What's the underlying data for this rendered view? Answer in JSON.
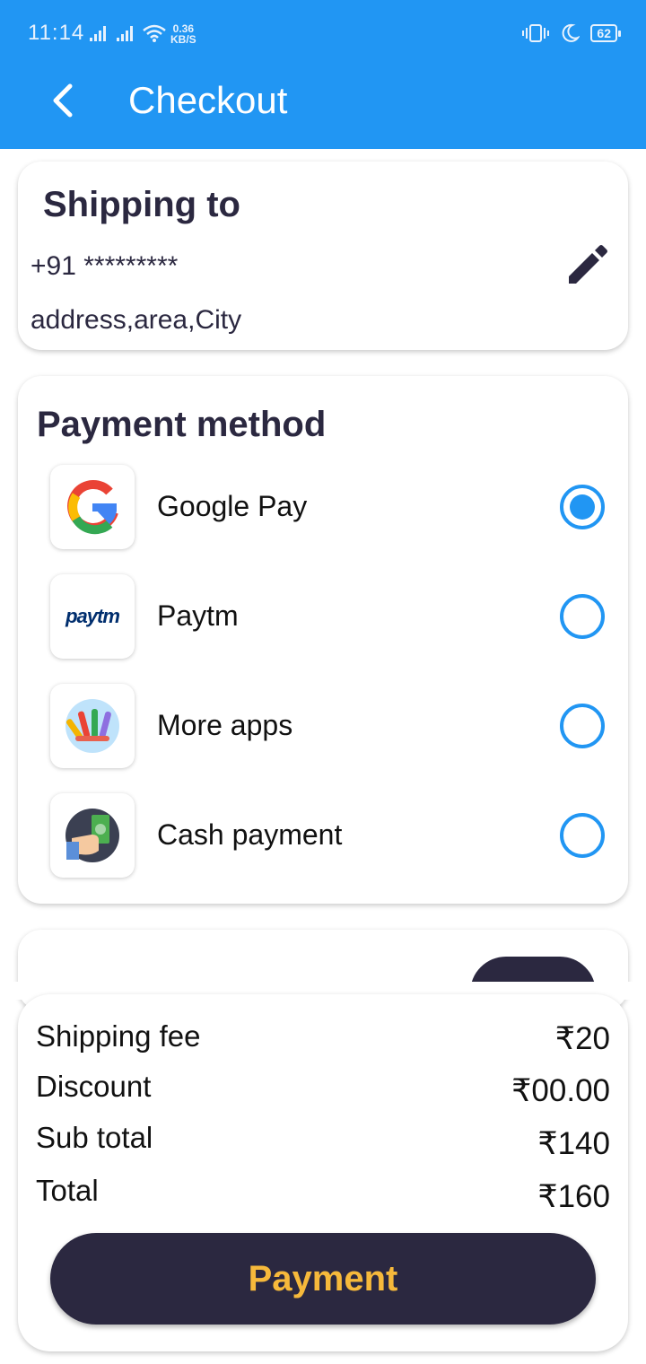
{
  "status_bar": {
    "time": "11:14",
    "net_speed_value": "0.36",
    "net_speed_unit": "KB/S",
    "battery": "62"
  },
  "app_bar": {
    "title": "Checkout",
    "back_icon": "arrow-back-icon"
  },
  "shipping": {
    "title": "Shipping to",
    "phone": "+91 *********",
    "address": "address,area,City",
    "edit_icon": "pencil-icon"
  },
  "payment": {
    "title": "Payment method",
    "methods": [
      {
        "label": "Google Pay",
        "icon": "google-pay-icon",
        "selected": true
      },
      {
        "label": "Paytm",
        "icon": "paytm-icon",
        "logo_text": "paytm",
        "selected": false
      },
      {
        "label": "More apps",
        "icon": "more-apps-icon",
        "selected": false
      },
      {
        "label": "Cash payment",
        "icon": "cash-payment-icon",
        "selected": false
      }
    ]
  },
  "summary": {
    "shipping_fee_label": "Shipping fee",
    "shipping_fee_value": "₹20",
    "discount_label": "Discount",
    "discount_value": "₹00.00",
    "subtotal_label": "Sub total",
    "subtotal_value": "₹140",
    "total_label": "Total",
    "total_value": "₹160",
    "button_label": "Payment"
  },
  "colors": {
    "primary": "#2196f3",
    "dark": "#2b2840",
    "accent": "#f6b93b"
  }
}
